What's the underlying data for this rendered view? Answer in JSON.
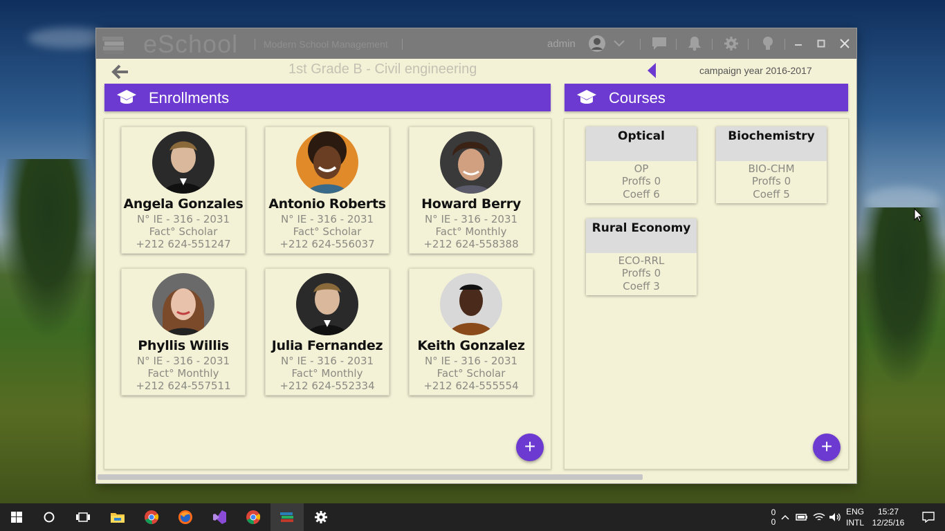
{
  "window": {
    "app_name": "eSchool",
    "tagline": "Modern School Management",
    "user": "admin"
  },
  "subheader": {
    "class_title": "1st Grade B - Civil engineering",
    "campaign": "campaign year 2016-2017"
  },
  "enrollments": {
    "title": "Enrollments",
    "students": [
      {
        "name": "Angela Gonzales",
        "number": "N° IE - 316 - 2031",
        "fact": "Fact° Scholar",
        "phone": "+212 624-551247"
      },
      {
        "name": "Antonio Roberts",
        "number": "N° IE - 316 - 2031",
        "fact": "Fact° Scholar",
        "phone": "+212 624-556037"
      },
      {
        "name": "Howard Berry",
        "number": "N° IE - 316 - 2031",
        "fact": "Fact° Monthly",
        "phone": "+212 624-558388"
      },
      {
        "name": "Phyllis Willis",
        "number": "N° IE - 316 - 2031",
        "fact": "Fact° Monthly",
        "phone": "+212 624-557511"
      },
      {
        "name": "Julia Fernandez",
        "number": "N° IE - 316 - 2031",
        "fact": "Fact° Monthly",
        "phone": "+212 624-552334"
      },
      {
        "name": "Keith Gonzalez",
        "number": "N° IE - 316 - 2031",
        "fact": "Fact° Scholar",
        "phone": "+212 624-555554"
      }
    ]
  },
  "courses": {
    "title": "Courses",
    "items": [
      {
        "name": "Optical",
        "code": "OP",
        "proffs": "Proffs 0",
        "coeff": "Coeff 6"
      },
      {
        "name": "Biochemistry",
        "code": "BIO-CHM",
        "proffs": "Proffs 0",
        "coeff": "Coeff 5"
      },
      {
        "name": "Rural Economy",
        "code": "ECO-RRL",
        "proffs": "Proffs 0",
        "coeff": "Coeff 3"
      }
    ]
  },
  "fab_label": "+",
  "taskbar": {
    "notify_count_top": "0",
    "notify_count_bottom": "0",
    "lang_top": "ENG",
    "lang_bottom": "INTL",
    "time": "15:27",
    "date": "12/25/16"
  },
  "colors": {
    "accent": "#6c3ad0",
    "window_bg": "#f3f1d6",
    "titlebar": "#7a7a7a"
  }
}
